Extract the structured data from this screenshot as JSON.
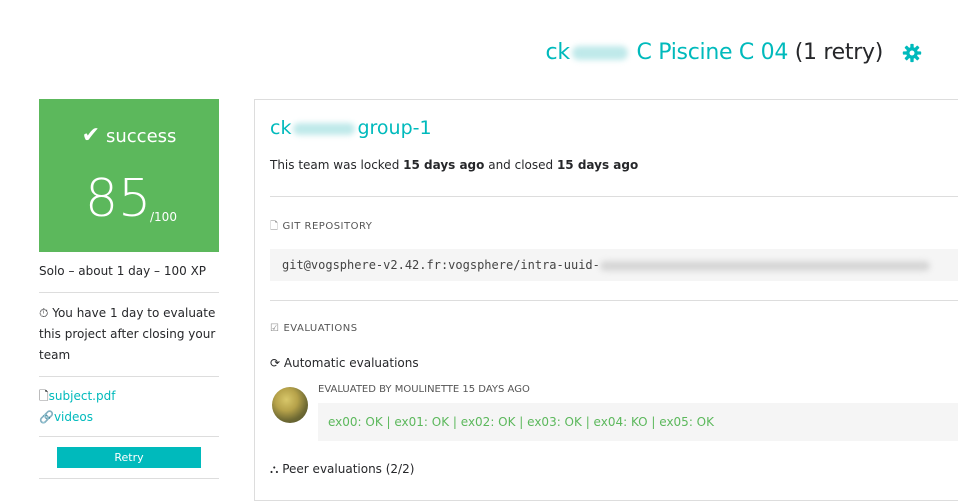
{
  "header": {
    "login_prefix": "ck",
    "project": "C Piscine C 04",
    "retry": "(1 retry)",
    "icon": "gear-icon"
  },
  "score": {
    "status": "success",
    "value": "85",
    "max": "/100"
  },
  "side": {
    "meta": "Solo – about 1 day – 100 XP",
    "notice": "You have 1 day to evaluate this project after closing your team",
    "links": [
      "subject.pdf",
      "videos"
    ],
    "retry_button": "Retry"
  },
  "team": {
    "name_prefix": "ck",
    "name_suffix": "group-1",
    "locked_text_1": "This team was locked ",
    "locked_time": "15 days ago",
    "locked_text_2": " and closed ",
    "closed_time": "15 days ago"
  },
  "repo": {
    "title": "GIT REPOSITORY",
    "url": "git@vogsphere-v2.42.fr:vogsphere/intra-uuid-"
  },
  "evaluations": {
    "title": "EVALUATIONS",
    "auto_title": "Automatic evaluations",
    "evaluated_by": "EVALUATED BY MOULINETTE 15 DAYS AGO",
    "result": "ex00: OK | ex01: OK | ex02: OK | ex03: OK | ex04: KO | ex05: OK",
    "peer_title": "Peer evaluations (2/2)"
  },
  "colors": {
    "accent": "#00babc",
    "success": "#5cb85c"
  }
}
